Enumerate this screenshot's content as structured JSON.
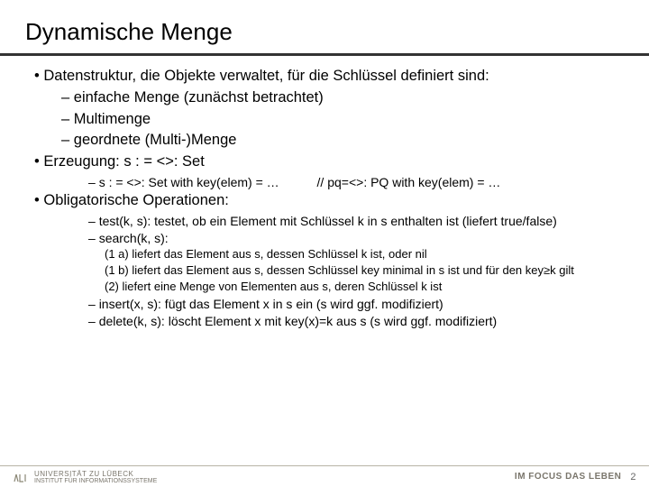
{
  "title": "Dynamische Menge",
  "bullets": {
    "b1": "Datenstruktur, die Objekte verwaltet, für die Schlüssel definiert sind:",
    "b1a": "einfache Menge (zunächst betrachtet)",
    "b1b": "Multimenge",
    "b1c": "geordnete (Multi-)Menge",
    "b2": "Erzeugung: s : = <>: Set",
    "b2a": "s : = <>: Set with key(elem) = …",
    "b2a_comment": "// pq=<>: PQ with key(elem) = …",
    "b3": "Obligatorische Operationen:",
    "b3a": "test(k, s): testet, ob ein Element mit Schlüssel k in s enthalten ist (liefert true/false)",
    "b3b": "search(k, s):",
    "b3b1": "(1 a) liefert das Element aus s, dessen Schlüssel k ist, oder nil",
    "b3b2": "(1 b) liefert das Element aus s, dessen Schlüssel key minimal in s ist und für den key≥k gilt",
    "b3b3": "(2) liefert eine Menge von Elementen aus s, deren Schlüssel k ist",
    "b3c": "insert(x, s): fügt das Element x in s ein (s wird ggf. modifiziert)",
    "b3d": "delete(k, s): löscht Element x mit key(x)=k aus s (s wird ggf. modifiziert)"
  },
  "footer": {
    "uni": "UNIVERSITÄT ZU LÜBECK",
    "inst": "INSTITUT FÜR INFORMATIONSSYSTEME",
    "motto": "IM FOCUS DAS LEBEN",
    "page": "2"
  }
}
